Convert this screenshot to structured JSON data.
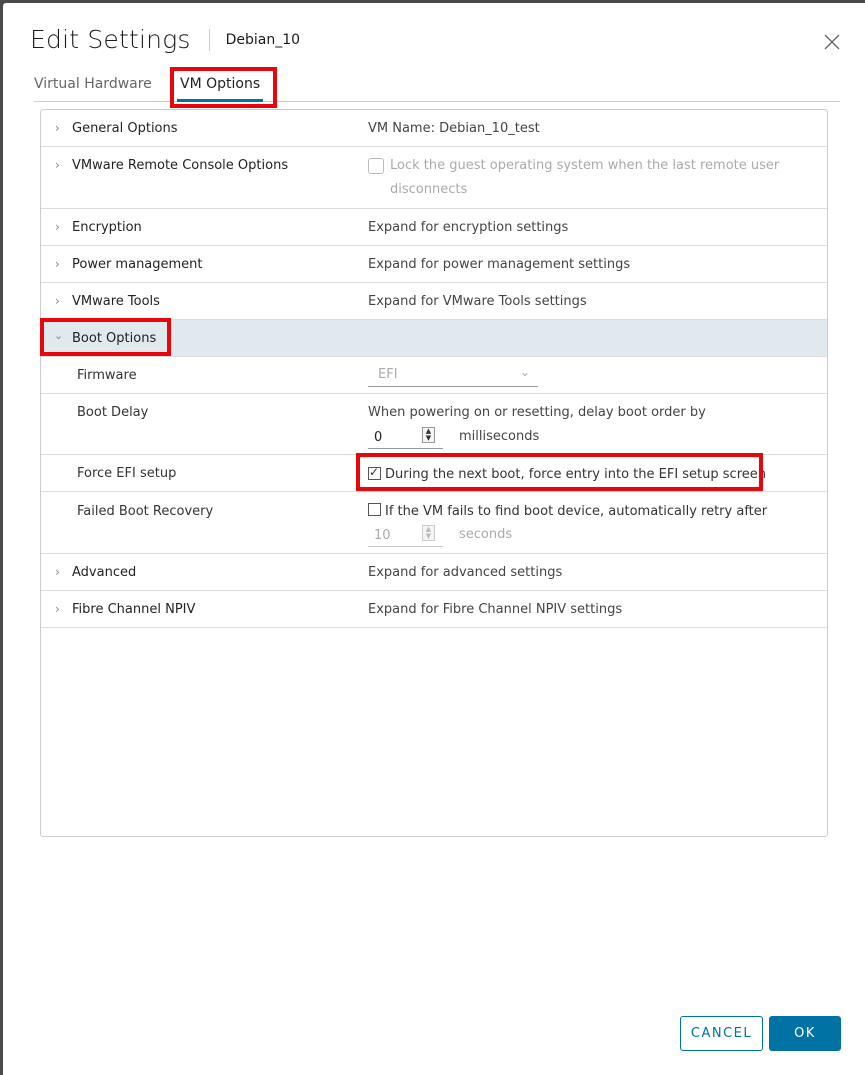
{
  "dialog": {
    "title": "Edit Settings",
    "subtitle": "Debian_10",
    "close_icon": "close-icon"
  },
  "tabs": [
    {
      "label": "Virtual Hardware",
      "active": false
    },
    {
      "label": "VM Options",
      "active": true
    }
  ],
  "sections": {
    "general": {
      "label": "General Options",
      "value": "VM Name: Debian_10_test"
    },
    "remote_console": {
      "label": "VMware Remote Console Options",
      "checkbox_label_line1": "Lock the guest operating system when the last remote user",
      "checkbox_label_line2": "disconnects",
      "checked": false,
      "disabled": true
    },
    "encryption": {
      "label": "Encryption",
      "value": "Expand for encryption settings"
    },
    "power": {
      "label": "Power management",
      "value": "Expand for power management settings"
    },
    "tools": {
      "label": "VMware Tools",
      "value": "Expand for VMware Tools settings"
    },
    "boot": {
      "label": "Boot Options",
      "expanded": true,
      "firmware": {
        "label": "Firmware",
        "value": "EFI"
      },
      "boot_delay": {
        "label": "Boot Delay",
        "description": "When powering on or resetting, delay boot order by",
        "value": "0",
        "unit": "milliseconds"
      },
      "force_efi": {
        "label": "Force EFI setup",
        "checkbox_label": "During the next boot, force entry into the EFI setup screen",
        "checked": true
      },
      "failed_recovery": {
        "label": "Failed Boot Recovery",
        "checkbox_label": "If the VM fails to find boot device, automatically retry after",
        "checked": false,
        "value": "10",
        "unit": "seconds"
      }
    },
    "advanced": {
      "label": "Advanced",
      "value": "Expand for advanced settings"
    },
    "npiv": {
      "label": "Fibre Channel NPIV",
      "value": "Expand for Fibre Channel NPIV settings"
    }
  },
  "footer": {
    "cancel_label": "CANCEL",
    "ok_label": "OK"
  },
  "colors": {
    "accent": "#0072a3",
    "highlight": "#e8060c",
    "selected_row": "#dfe9ee"
  }
}
